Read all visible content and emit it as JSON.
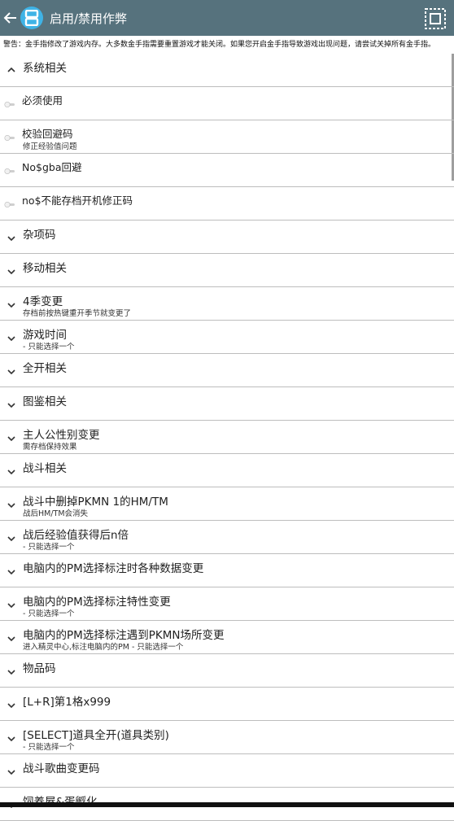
{
  "appbar": {
    "title": "启用/禁用作弊",
    "back_icon": "arrow-back-icon",
    "logo_icon": "ds-app-logo-icon",
    "grid_icon": "select-all-grid-icon"
  },
  "warning": "警告：金手指修改了游戏内存。大多数金手指需要重置游戏才能关闭。如果您开启金手指导致游戏出现问题，请尝试关掉所有金手指。",
  "rows": [
    {
      "kind": "group",
      "expanded": true,
      "title": "系统相关",
      "sub": ""
    },
    {
      "kind": "item",
      "title": "必须使用",
      "sub": ""
    },
    {
      "kind": "item",
      "title": "校验回避码",
      "sub": "修正经验值问题"
    },
    {
      "kind": "item",
      "title": "No$gba回避",
      "sub": ""
    },
    {
      "kind": "item",
      "title": "no$不能存档开机修正码",
      "sub": ""
    },
    {
      "kind": "group",
      "expanded": false,
      "title": "杂项码",
      "sub": ""
    },
    {
      "kind": "group",
      "expanded": false,
      "title": "移动相关",
      "sub": ""
    },
    {
      "kind": "group",
      "expanded": false,
      "title": "4季变更",
      "sub": "存档前按热键重开季节就变更了"
    },
    {
      "kind": "group",
      "expanded": false,
      "title": "游戏时间",
      "sub": "- 只能选择一个"
    },
    {
      "kind": "group",
      "expanded": false,
      "title": "全开相关",
      "sub": ""
    },
    {
      "kind": "group",
      "expanded": false,
      "title": "图鉴相关",
      "sub": ""
    },
    {
      "kind": "group",
      "expanded": false,
      "title": "主人公性别变更",
      "sub": "需存档保持效果"
    },
    {
      "kind": "group",
      "expanded": false,
      "title": "战斗相关",
      "sub": ""
    },
    {
      "kind": "group",
      "expanded": false,
      "title": "战斗中删掉PKMN 1的HM/TM",
      "sub": "战后HM/TM会消失"
    },
    {
      "kind": "group",
      "expanded": false,
      "title": "战后经验值获得后n倍",
      "sub": "- 只能选择一个"
    },
    {
      "kind": "group",
      "expanded": false,
      "title": "电脑内的PM选择标注时各种数据变更",
      "sub": ""
    },
    {
      "kind": "group",
      "expanded": false,
      "title": "电脑内的PM选择标注特性变更",
      "sub": "- 只能选择一个"
    },
    {
      "kind": "group",
      "expanded": false,
      "title": "电脑内的PM选择标注遇到PKMN场所变更",
      "sub": "进入精灵中心,标注电脑内的PM - 只能选择一个"
    },
    {
      "kind": "group",
      "expanded": false,
      "title": "物品码",
      "sub": ""
    },
    {
      "kind": "group",
      "expanded": false,
      "title": "[L+R]第1格x999",
      "sub": ""
    },
    {
      "kind": "group",
      "expanded": false,
      "title": "[SELECT]道具全开(道具类别)",
      "sub": "- 只能选择一个"
    },
    {
      "kind": "group",
      "expanded": false,
      "title": "战斗歌曲变更码",
      "sub": ""
    },
    {
      "kind": "group",
      "expanded": false,
      "title": "饲养屋&蛋孵化",
      "sub": ""
    }
  ]
}
